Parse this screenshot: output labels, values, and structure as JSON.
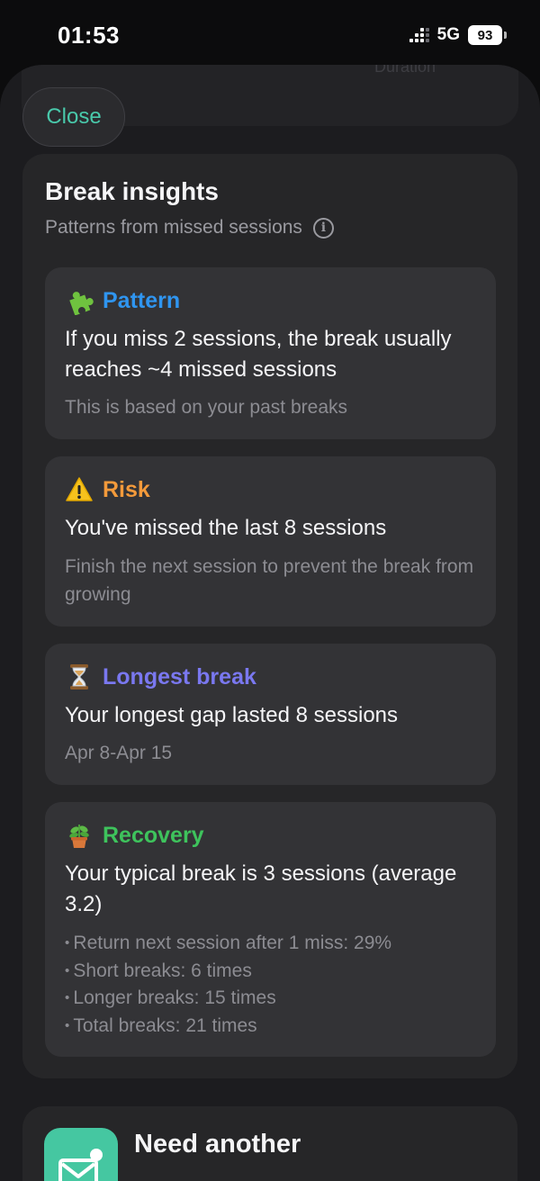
{
  "status_bar": {
    "time": "01:53",
    "network": "5G",
    "battery": "93"
  },
  "ghost": {
    "text": "Duration"
  },
  "close_label": "Close",
  "insights": {
    "title": "Break insights",
    "subtitle": "Patterns from missed sessions",
    "cards": [
      {
        "icon": "puzzle-icon",
        "label": "Pattern",
        "color": "#2f95f0",
        "main": "If you miss 2 sessions, the break usually reaches ~4 missed sessions",
        "note": "This is based on your past breaks"
      },
      {
        "icon": "warning-icon",
        "label": "Risk",
        "color": "#f39a3b",
        "main": "You've missed the last 8 sessions",
        "note": "Finish the next session to prevent the break from growing"
      },
      {
        "icon": "hourglass-icon",
        "label": "Longest break",
        "color": "#7a78f0",
        "main": "Your longest gap lasted 8 sessions",
        "note": "Apr 8-Apr 15"
      },
      {
        "icon": "potted-plant-icon",
        "label": "Recovery",
        "color": "#3ec35c",
        "main": "Your typical break is 3 sessions (average 3.2)",
        "bullets": [
          "Return next session after 1 miss: 29%",
          "Short breaks: 6 times",
          "Longer breaks: 15 times",
          "Total breaks: 21 times"
        ]
      }
    ]
  },
  "bottom_card": {
    "icon": "mail-icon",
    "title": "Need another"
  }
}
